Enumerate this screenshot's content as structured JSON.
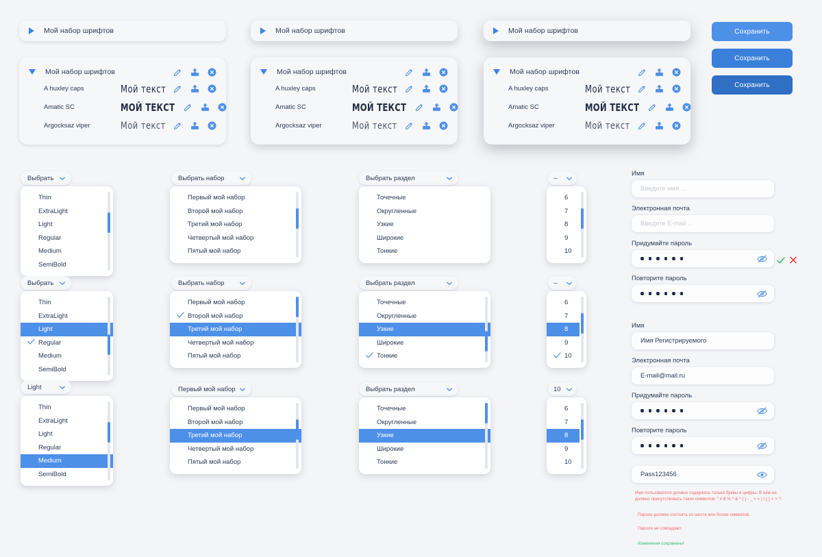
{
  "colors": {
    "accent": "#4d90e8",
    "accent_mid": "#3a7fd9",
    "accent_dark": "#2f6fc4",
    "text": "#2b3a55",
    "error": "#f4626e",
    "success": "#2fbd6d",
    "page_bg": "#f4f5f7"
  },
  "font_sets": {
    "collapsed_title": "Мой набор шрифтов",
    "expanded_title": "Мой набор шрифтов",
    "rows": [
      {
        "name": "A huxley caps",
        "sample": "Мой текст"
      },
      {
        "name": "Amatic SC",
        "sample": "МОЙ ТЕКСТ"
      },
      {
        "name": "Argocksaz viper",
        "sample": "Мой текст"
      }
    ],
    "row_icons": [
      "edit-icon",
      "upload-icon",
      "delete-icon"
    ]
  },
  "save_buttons": [
    {
      "label": "Сохранить",
      "variant": "light"
    },
    {
      "label": "Сохранить",
      "variant": "mid"
    },
    {
      "label": "Сохранить",
      "variant": "dark"
    }
  ],
  "weight_select": {
    "options": [
      "Thin",
      "ExtraLight",
      "Light",
      "Regular",
      "Medium",
      "SemiBold"
    ],
    "states": [
      {
        "trigger": "Выбрать",
        "highlighted": null,
        "checked": null
      },
      {
        "trigger": "Выбрать",
        "highlighted": "Light",
        "checked": "Regular"
      },
      {
        "trigger": "Light",
        "highlighted": "Medium",
        "checked": null
      }
    ]
  },
  "set_select": {
    "options": [
      "Первый мой набор",
      "Второй мой набор",
      "Третий мой набор",
      "Четвертый мой набор",
      "Пятый мой набор"
    ],
    "states": [
      {
        "trigger": "Выбрать набор",
        "highlighted": null,
        "checked": null
      },
      {
        "trigger": "Выбрать набор",
        "highlighted": "Третий мой набор",
        "checked": "Второй мой набор"
      },
      {
        "trigger": "Первый мой набор",
        "highlighted": "Третий мой набор",
        "checked": null
      }
    ]
  },
  "section_select": {
    "options": [
      "Точечные",
      "Округленные",
      "Узкие",
      "Широкие",
      "Тонкие"
    ],
    "states": [
      {
        "trigger": "Выбрать раздел",
        "highlighted": null,
        "checked": null
      },
      {
        "trigger": "Выбрать раздел",
        "highlighted": "Узкие",
        "checked": "Тонкие"
      },
      {
        "trigger": "Выбрать раздел",
        "highlighted": "Узкие",
        "checked": null
      }
    ]
  },
  "size_select": {
    "options": [
      "6",
      "7",
      "8",
      "9",
      "10"
    ],
    "states": [
      {
        "trigger": "--",
        "highlighted": null,
        "checked": null
      },
      {
        "trigger": "--",
        "highlighted": "8",
        "checked": "10"
      },
      {
        "trigger": "10",
        "highlighted": "8",
        "checked": null
      }
    ]
  },
  "form_empty": {
    "name": {
      "label": "Имя",
      "value": "",
      "placeholder": "Введите имя ..."
    },
    "email": {
      "label": "Электронная почта",
      "value": "",
      "placeholder": "Введите E-mail ..."
    },
    "password": {
      "label": "Придумайте пароль",
      "dots": 6,
      "icon": "eye-off-icon"
    },
    "repeat": {
      "label": "Повторите пароль",
      "dots": 6,
      "icon": "eye-off-icon"
    },
    "validity": {
      "valid_icon": "check-icon",
      "invalid_icon": "cross-icon"
    }
  },
  "form_filled": {
    "name": {
      "label": "Имя",
      "value": "Имя Регистрируемого",
      "placeholder": "Введите имя ..."
    },
    "email": {
      "label": "Электронная почта",
      "value": "E-mail@mail.ru",
      "placeholder": "Введите E-mail ..."
    },
    "password": {
      "label": "Придумайте пароль",
      "dots": 6,
      "icon": "eye-off-icon"
    },
    "repeat": {
      "label": "Повторите пароль",
      "dots": 6,
      "icon": "eye-off-icon"
    },
    "revealed": {
      "value": "Pass123456",
      "icon": "eye-icon"
    }
  },
  "messages": [
    {
      "type": "error",
      "text": "Имя пользователя должно содержать только буквы и цифры. В нём не должно присутствовать таких символов: \" # $ % ^ & * ( ) - _ + = | \\ { } < > ?"
    },
    {
      "type": "error",
      "text": "Пароль должен состоять из шести или более символов."
    },
    {
      "type": "error",
      "text": "Пароли не совпадают."
    },
    {
      "type": "success",
      "text": "Изменения сохранены!"
    }
  ]
}
